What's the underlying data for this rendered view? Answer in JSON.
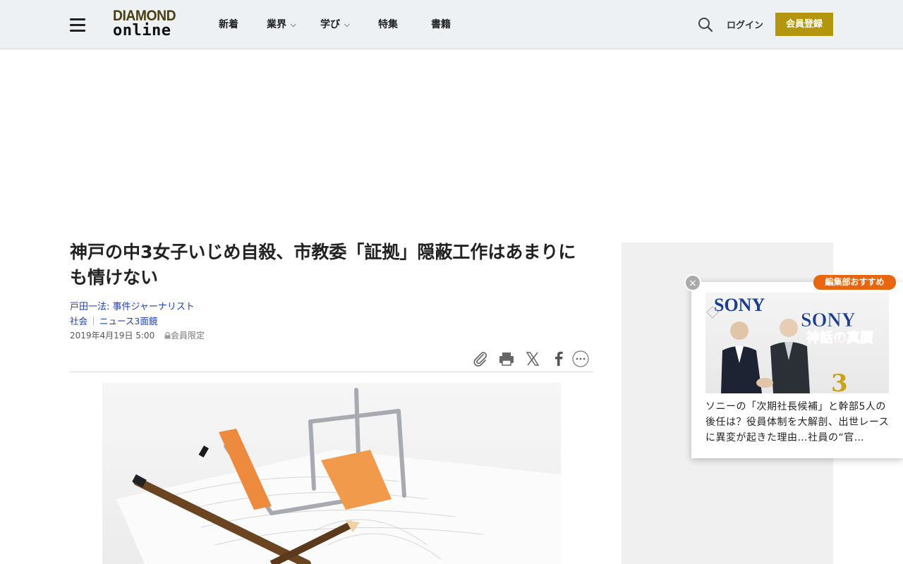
{
  "header": {
    "logo_top": "DIAMOND",
    "logo_bottom": "online",
    "nav": [
      {
        "label": "新着"
      },
      {
        "label": "業界"
      },
      {
        "label": "学び"
      },
      {
        "label": "特集"
      },
      {
        "label": "書籍"
      }
    ],
    "login": "ログイン",
    "register": "会員登録"
  },
  "article": {
    "title": "神戸の中3女子いじめ自殺、市教委「証拠」隠蔽工作はあまりにも情けない",
    "author": "戸田一法: 事件ジャーナリスト",
    "categories": [
      "社会",
      "ニュース3面鏡"
    ],
    "date": "2019年4月19日 5:00",
    "members_only": "会員限定"
  },
  "share": [
    "clip-icon",
    "print-icon",
    "x-icon",
    "facebook-icon",
    "more-icon"
  ],
  "popup": {
    "badge": "編集部おすすめ",
    "close": "×",
    "image_text_left": "SONY",
    "image_text_right": "SONY",
    "image_caption": "神話の真贋",
    "image_number": "3",
    "headline": "ソニーの「次期社長候補」と幹部5人の後任は？役員体制を大解剖、出世レースに異変が起きた理由…社員の“官…"
  },
  "colors": {
    "accent": "#b3960d",
    "link": "#1a3fb0",
    "badge": "#e8670e"
  }
}
